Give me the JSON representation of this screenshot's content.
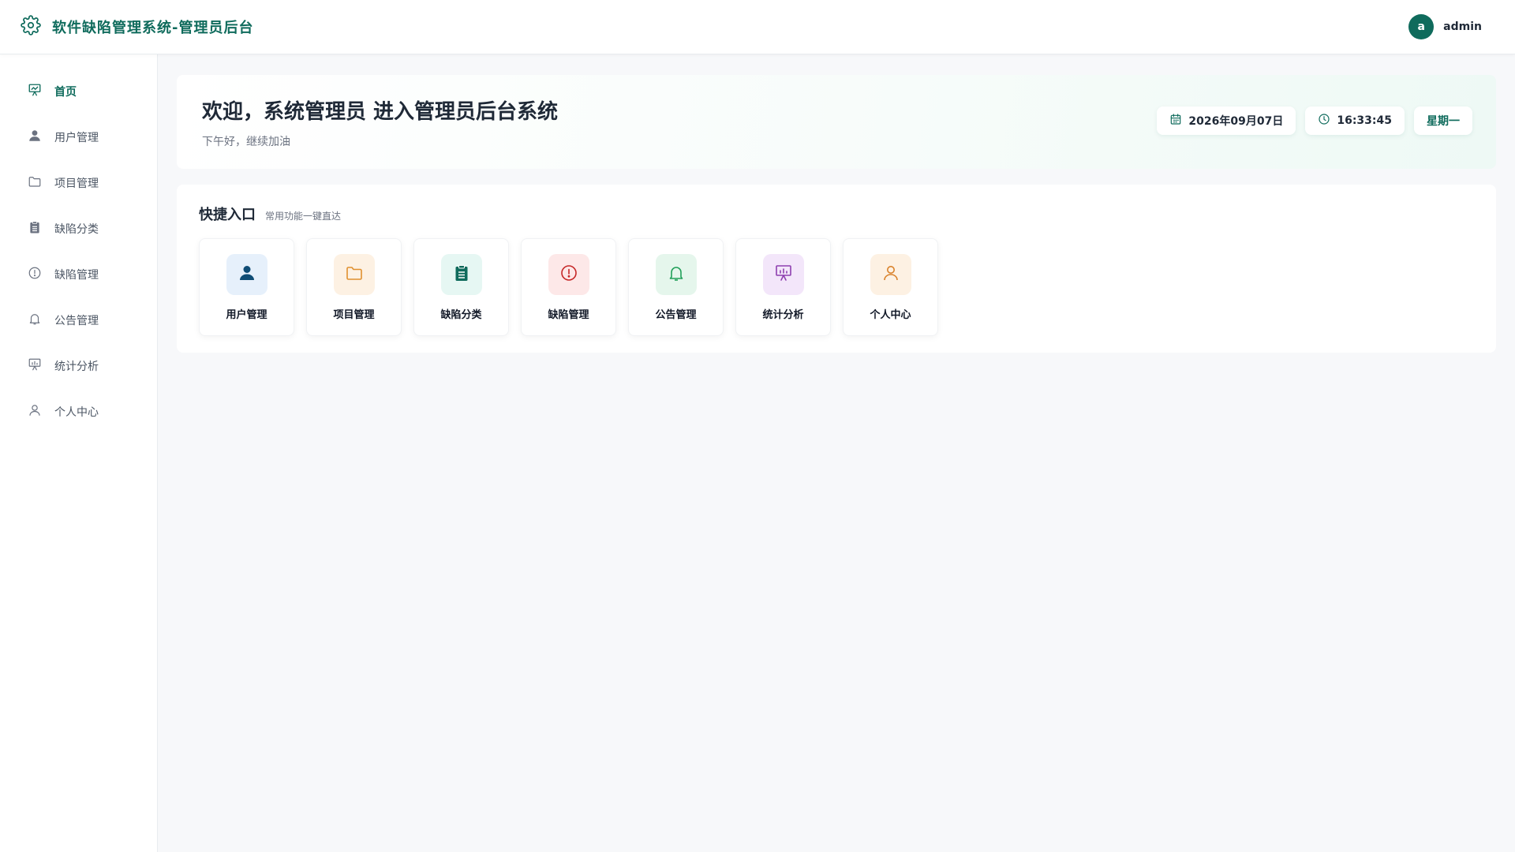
{
  "app": {
    "title": "软件缺陷管理系统-管理员后台"
  },
  "user": {
    "avatar_letter": "a",
    "name": "admin"
  },
  "sidebar": {
    "items": [
      {
        "label": "首页",
        "icon": "presentation-chart-icon",
        "active": true
      },
      {
        "label": "用户管理",
        "icon": "user-filled-icon",
        "active": false
      },
      {
        "label": "项目管理",
        "icon": "folder-icon",
        "active": false
      },
      {
        "label": "缺陷分类",
        "icon": "clipboard-icon",
        "active": false
      },
      {
        "label": "缺陷管理",
        "icon": "alert-circle-icon",
        "active": false
      },
      {
        "label": "公告管理",
        "icon": "bell-icon",
        "active": false
      },
      {
        "label": "统计分析",
        "icon": "presentation-chart-icon",
        "active": false
      },
      {
        "label": "个人中心",
        "icon": "user-outline-icon",
        "active": false
      }
    ]
  },
  "welcome": {
    "title": "欢迎，系统管理员 进入管理员后台系统",
    "subtitle": "下午好，继续加油",
    "date": "2026年09月07日",
    "time": "16:33:45",
    "weekday": "星期一"
  },
  "quick": {
    "title": "快捷入口",
    "subtitle": "常用功能一键直达",
    "cards": [
      {
        "label": "用户管理",
        "icon": "user-filled-icon",
        "color": "#0f4c75",
        "bg": "#e6f0fb"
      },
      {
        "label": "项目管理",
        "icon": "folder-icon",
        "color": "#e0902f",
        "bg": "#fdf1e3"
      },
      {
        "label": "缺陷分类",
        "icon": "clipboard-icon",
        "color": "#0f6b5c",
        "bg": "#e6f7f3"
      },
      {
        "label": "缺陷管理",
        "icon": "alert-circle-icon",
        "color": "#c62828",
        "bg": "#fde8e8"
      },
      {
        "label": "公告管理",
        "icon": "bell-icon",
        "color": "#22a05a",
        "bg": "#e5f6ec"
      },
      {
        "label": "统计分析",
        "icon": "presentation-chart-icon",
        "color": "#8e3fb0",
        "bg": "#f3e6fa"
      },
      {
        "label": "个人中心",
        "icon": "user-outline-icon",
        "color": "#d9822b",
        "bg": "#fdf1e3"
      }
    ]
  },
  "colors": {
    "accent": "#0f6b5c",
    "background": "#f7f8fa"
  }
}
